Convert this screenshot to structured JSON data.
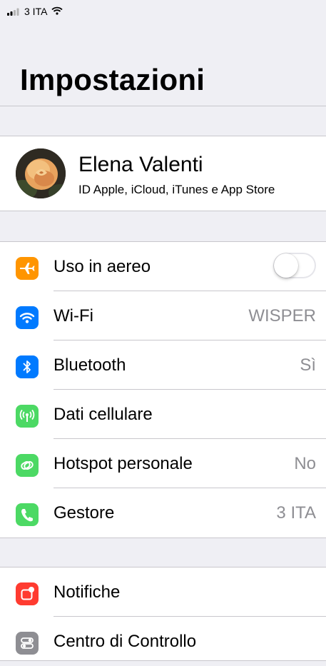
{
  "status_bar": {
    "carrier": "3 ITA",
    "signal_icon": "signal-bars-icon",
    "wifi_icon": "wifi-icon"
  },
  "header": {
    "title": "Impostazioni"
  },
  "profile": {
    "name": "Elena Valenti",
    "subtitle": "ID Apple, iCloud, iTunes e App Store",
    "avatar_icon": "rose-photo-avatar"
  },
  "network": {
    "airplane": {
      "label": "Uso in aereo",
      "toggle_on": false,
      "icon": "airplane-icon",
      "color": "#ff9500"
    },
    "wifi": {
      "label": "Wi-Fi",
      "value": "WISPER",
      "icon": "wifi-icon",
      "color": "#007aff"
    },
    "bluetooth": {
      "label": "Bluetooth",
      "value": "Sì",
      "icon": "bluetooth-icon",
      "color": "#007aff"
    },
    "cellular": {
      "label": "Dati cellulare",
      "icon": "antenna-icon",
      "color": "#4cd964"
    },
    "hotspot": {
      "label": "Hotspot personale",
      "value": "No",
      "icon": "hotspot-icon",
      "color": "#4cd964"
    },
    "carrier": {
      "label": "Gestore",
      "value": "3 ITA",
      "icon": "phone-icon",
      "color": "#4cd964"
    }
  },
  "system": {
    "notifications": {
      "label": "Notifiche",
      "icon": "notifications-icon",
      "color": "#ff3b30"
    },
    "control_center": {
      "label": "Centro di Controllo",
      "icon": "control-center-icon",
      "color": "#8e8e93"
    }
  },
  "colors": {
    "background": "#efeff4",
    "separator": "#c8c7cc",
    "secondary_text": "#8e8e93"
  }
}
